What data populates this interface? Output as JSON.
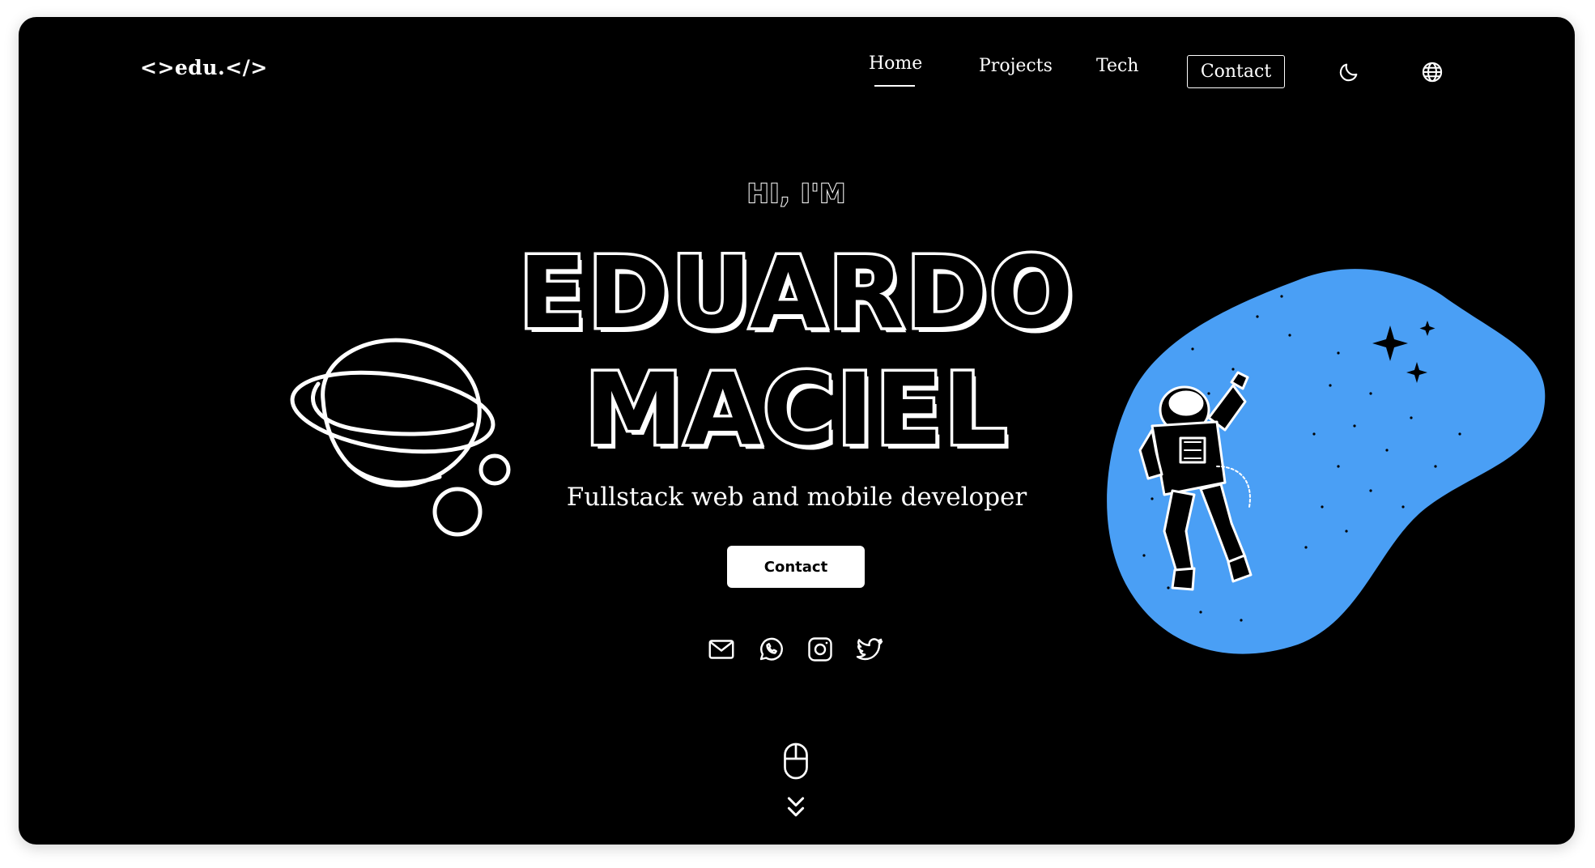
{
  "header": {
    "logo": "<>edu.</>",
    "nav": {
      "home": "Home",
      "projects": "Projects",
      "tech": "Tech",
      "contact": "Contact"
    },
    "icons": [
      "moon-icon",
      "globe-icon"
    ]
  },
  "hero": {
    "greeting": "HI, I'M",
    "name_first": "EDUARDO",
    "name_last": "MACIEL",
    "subtitle": "Fullstack web and mobile developer",
    "cta_label": "Contact",
    "social_icons": [
      "mail-icon",
      "whatsapp-icon",
      "instagram-icon",
      "twitter-icon"
    ]
  },
  "illustrations": {
    "left": "planet-illustration",
    "right": "astronaut-illustration"
  },
  "colors": {
    "background": "#000000",
    "foreground": "#ffffff",
    "blob": "#4a9ff5"
  }
}
